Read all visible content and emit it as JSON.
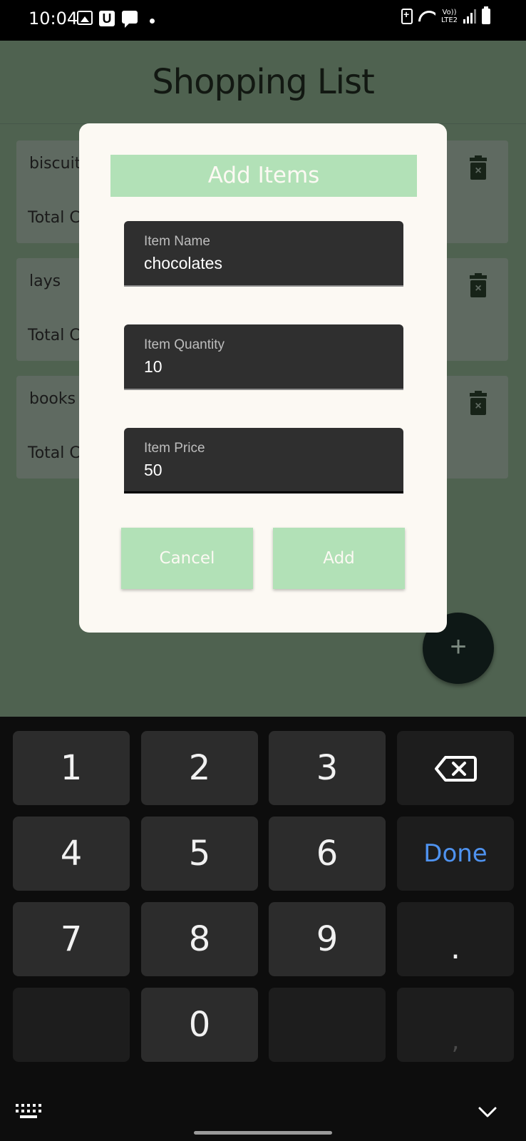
{
  "status_bar": {
    "time": "10:04",
    "network_label_top": "Vo))",
    "network_label_bottom": "LTE2"
  },
  "app": {
    "title": "Shopping List",
    "items": [
      {
        "name": "biscuits",
        "total_label": "Total Co"
      },
      {
        "name": "lays",
        "total_label": "Total Co"
      },
      {
        "name": "books",
        "total_label": "Total Co"
      }
    ],
    "fab_label": "+"
  },
  "dialog": {
    "title": "Add Items",
    "fields": {
      "name": {
        "label": "Item Name",
        "value": "chocolates"
      },
      "quantity": {
        "label": "Item Quantity",
        "value": "10"
      },
      "price": {
        "label": "Item Price",
        "value": "50"
      }
    },
    "cancel_label": "Cancel",
    "add_label": "Add"
  },
  "keyboard": {
    "keys": [
      "1",
      "2",
      "3",
      "4",
      "5",
      "6",
      "7",
      "8",
      "9",
      "0"
    ],
    "done_label": "Done",
    "period_label": ".",
    "comma_label": ","
  },
  "colors": {
    "accent": "#b2e1b7",
    "dialog_bg": "#fcf9f3",
    "done_blue": "#4f93f0"
  }
}
